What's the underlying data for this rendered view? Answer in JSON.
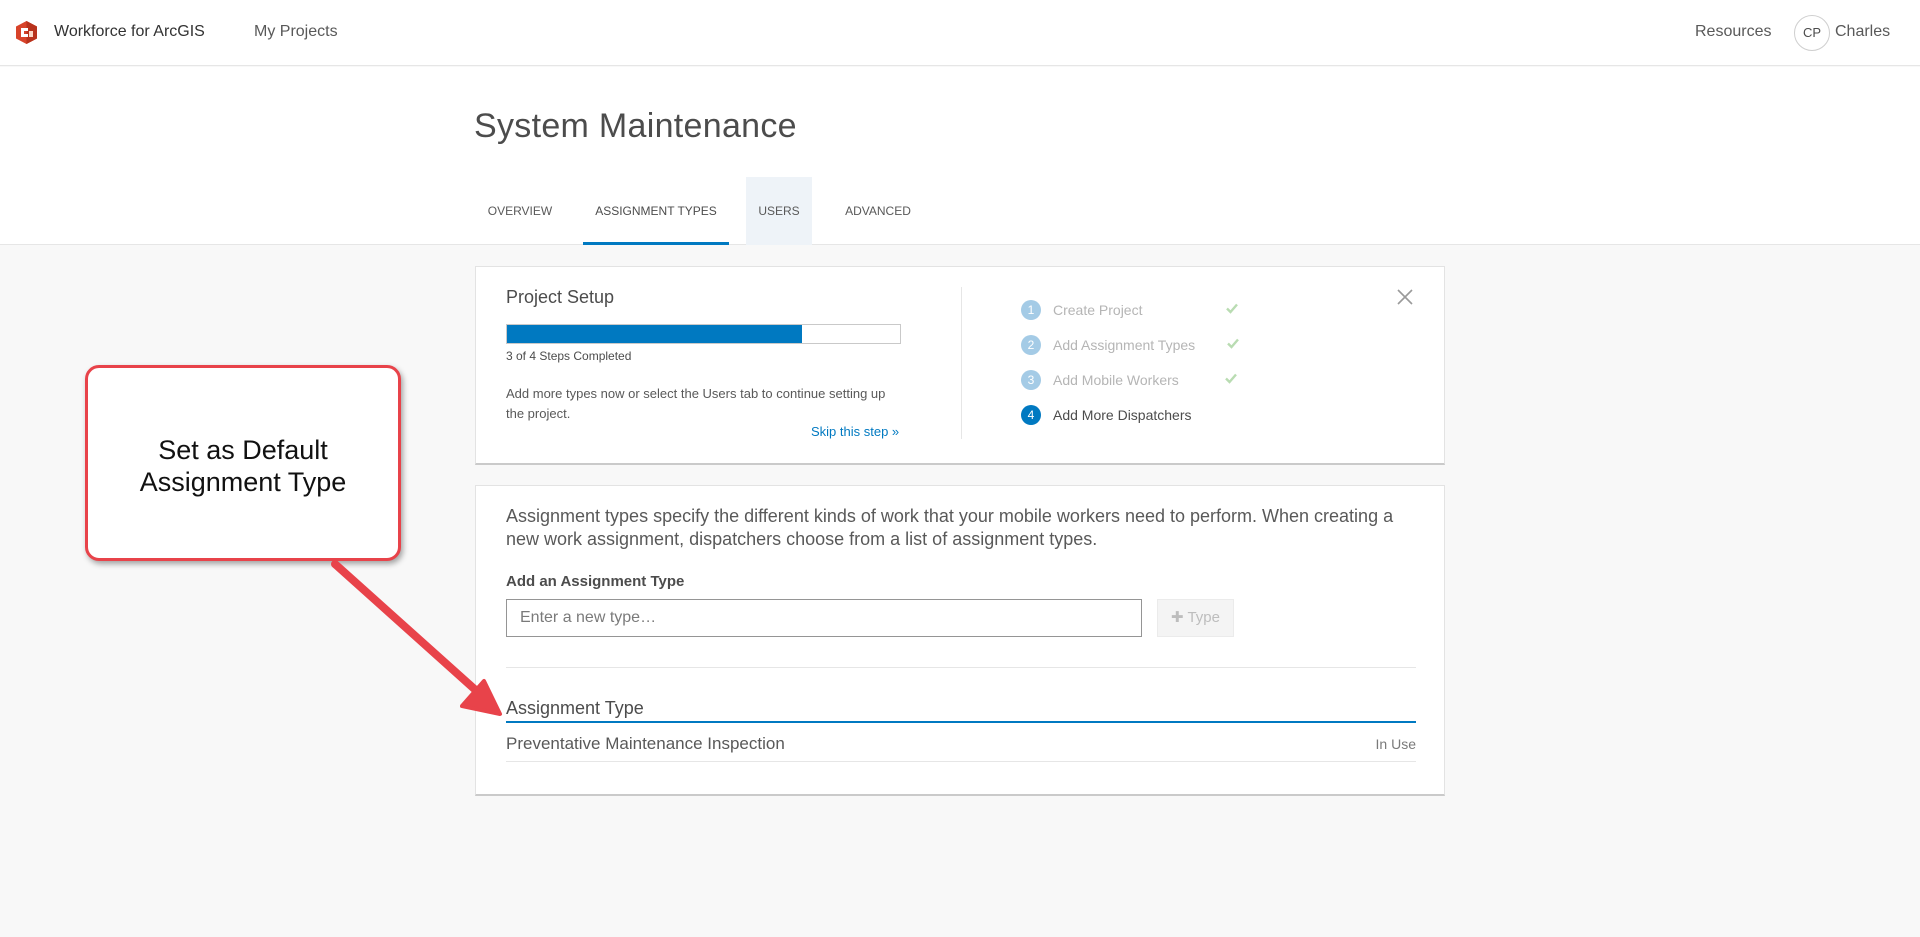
{
  "app": {
    "title": "Workforce for ArcGIS"
  },
  "nav": {
    "my_projects": "My Projects",
    "resources": "Resources",
    "user_initials": "CP",
    "user_name": "Charles"
  },
  "header": {
    "title": "System Maintenance",
    "tabs": [
      {
        "label": "OVERVIEW"
      },
      {
        "label": "ASSIGNMENT TYPES"
      },
      {
        "label": "USERS"
      },
      {
        "label": "ADVANCED"
      }
    ]
  },
  "setup": {
    "title": "Project Setup",
    "progress_fraction": 0.75,
    "progress_label": "3 of 4 Steps Completed",
    "description": "Add more types now or select the Users tab to continue setting up the project.",
    "skip_label": "Skip this step »",
    "steps": [
      {
        "number": "1",
        "label": "Create Project",
        "done": true
      },
      {
        "number": "2",
        "label": "Add Assignment Types",
        "done": true
      },
      {
        "number": "3",
        "label": "Add Mobile Workers",
        "done": true
      },
      {
        "number": "4",
        "label": "Add More Dispatchers",
        "done": false
      }
    ]
  },
  "types": {
    "description": "Assignment types specify the different kinds of work that your mobile workers need to perform. When creating a new work assignment, dispatchers choose from a list of assignment types.",
    "add_label": "Add an Assignment Type",
    "input_placeholder": "Enter a new type…",
    "add_button_label": "Type",
    "column_header": "Assignment Type",
    "rows": [
      {
        "name": "Preventative Maintenance Inspection",
        "status": "In Use"
      }
    ]
  },
  "callout": {
    "text": "Set as Default Assignment Type"
  },
  "colors": {
    "accent": "#0079c1",
    "callout_border": "#e8434a",
    "check": "#b9dcb2"
  }
}
